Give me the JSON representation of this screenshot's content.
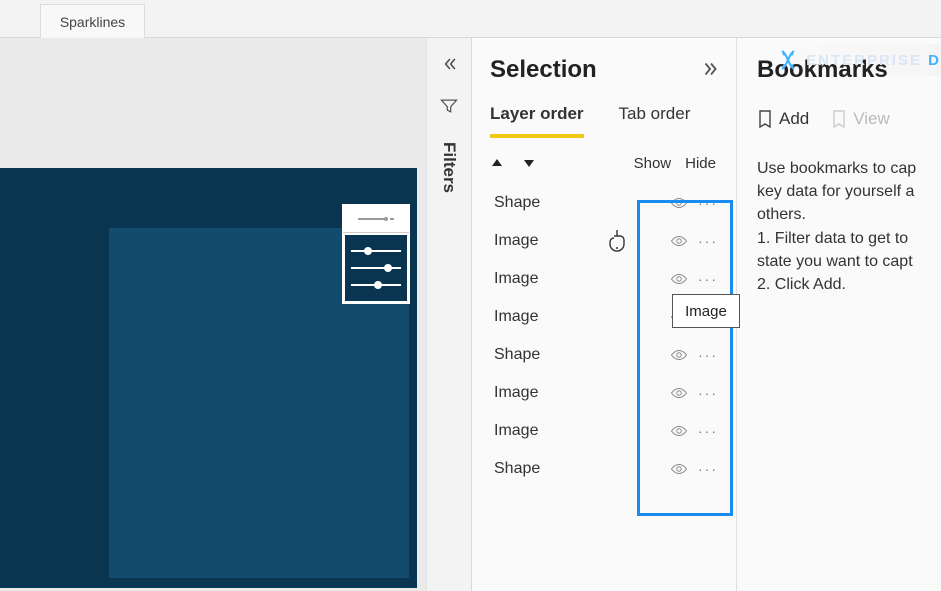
{
  "topbar": {
    "sparklines_label": "Sparklines"
  },
  "filters": {
    "label": "Filters"
  },
  "selection": {
    "title": "Selection",
    "tabs": {
      "layer": "Layer order",
      "tab_order": "Tab order"
    },
    "columns": {
      "show": "Show",
      "hide": "Hide"
    },
    "layers": [
      {
        "label": "Shape"
      },
      {
        "label": "Image"
      },
      {
        "label": "Image"
      },
      {
        "label": "Image"
      },
      {
        "label": "Shape"
      },
      {
        "label": "Image"
      },
      {
        "label": "Image"
      },
      {
        "label": "Shape"
      }
    ]
  },
  "tooltip": {
    "text": "Image"
  },
  "bookmarks": {
    "title": "Bookmarks",
    "add": "Add",
    "view": "View",
    "desc_line1": "Use bookmarks to cap",
    "desc_line2": "key data for yourself a",
    "desc_line3": "others.",
    "desc_line4": "1. Filter data to get to",
    "desc_line5": "state you want to capt",
    "desc_line6": "2. Click Add."
  },
  "branding": {
    "text_a": "ENTERPRISE",
    "text_b": "D"
  }
}
